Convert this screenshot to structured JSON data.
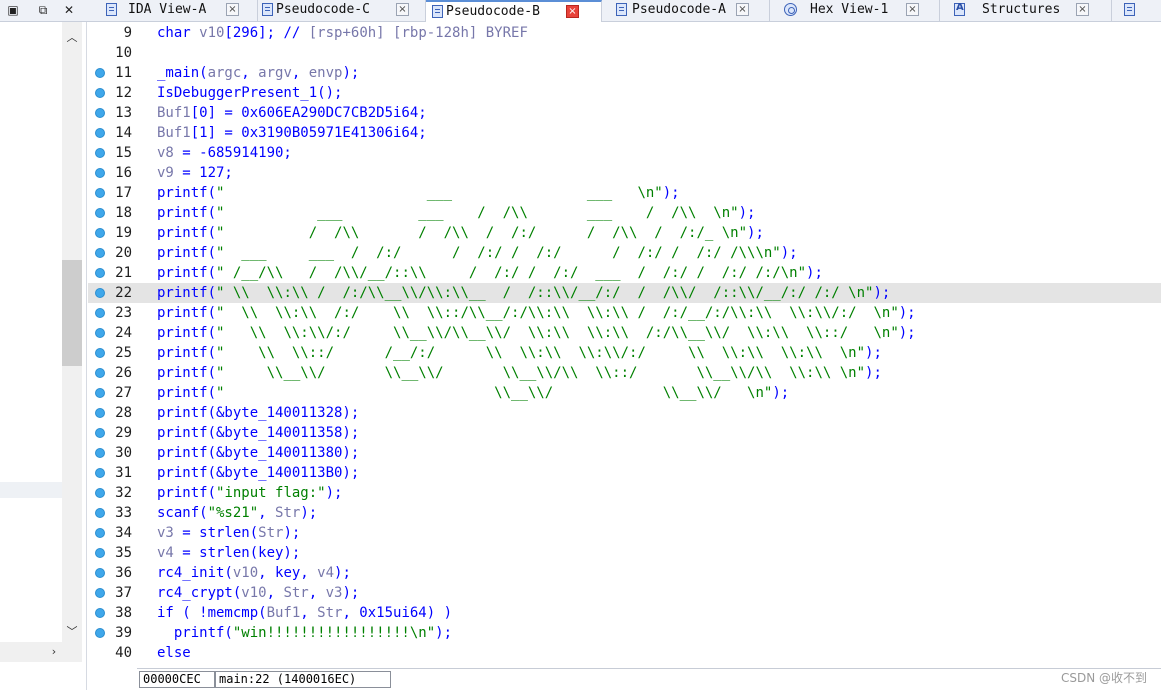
{
  "window_controls": {
    "float_icon": "window-float-icon",
    "restore_icon": "window-restore-icon",
    "close_icon": "window-close-icon"
  },
  "tabs": [
    {
      "label": "IDA View-A",
      "icon": "disassembly-view-icon",
      "active": false
    },
    {
      "label": "Pseudocode-C",
      "icon": "pseudocode-icon",
      "active": false
    },
    {
      "label": "Pseudocode-B",
      "icon": "pseudocode-icon",
      "active": true
    },
    {
      "label": "Pseudocode-A",
      "icon": "pseudocode-icon",
      "active": false
    },
    {
      "label": "Hex View-1",
      "icon": "hex-view-icon",
      "active": false
    },
    {
      "label": "Structures",
      "icon": "structures-icon",
      "active": false
    }
  ],
  "code": {
    "highlighted_line": 22,
    "lines": [
      {
        "num": "9",
        "bp": false,
        "text": "char v10[296]; // [rsp+60h] [rbp-128h] BYREF"
      },
      {
        "num": "10",
        "bp": false,
        "text": ""
      },
      {
        "num": "11",
        "bp": true,
        "text": "_main(argc, argv, envp);"
      },
      {
        "num": "12",
        "bp": true,
        "text": "IsDebuggerPresent_1();"
      },
      {
        "num": "13",
        "bp": true,
        "text": "Buf1[0] = 0x606EA290DC7CB2D5i64;"
      },
      {
        "num": "14",
        "bp": true,
        "text": "Buf1[1] = 0x3190B05971E41306i64;"
      },
      {
        "num": "15",
        "bp": true,
        "text": "v8 = -685914190;"
      },
      {
        "num": "16",
        "bp": true,
        "text": "v9 = 127;"
      },
      {
        "num": "17",
        "bp": true,
        "text": "printf(\"                        ___                ___   \\n\");"
      },
      {
        "num": "18",
        "bp": true,
        "text": "printf(\"           ___         ___    /  /\\\\       ___    /  /\\\\  \\n\");"
      },
      {
        "num": "19",
        "bp": true,
        "text": "printf(\"          /  /\\\\       /  /\\\\  /  /:/      /  /\\\\  /  /:/_ \\n\");"
      },
      {
        "num": "20",
        "bp": true,
        "text": "printf(\"  ___     ___  /  /:/      /  /:/ /  /:/      /  /:/ /  /:/ /\\\\\\n\");"
      },
      {
        "num": "21",
        "bp": true,
        "text": "printf(\" /__/\\\\   /  /\\\\/__/::\\\\     /  /:/ /  /:/  ___  /  /:/ /  /:/ /:/\\n\");"
      },
      {
        "num": "22",
        "bp": true,
        "text": "printf(\" \\\\  \\\\:\\\\ /  /:/\\\\__\\\\/\\\\:\\\\__  /  /::\\\\/__/:/  /  /\\\\/  /::\\\\/__/:/ /:/ \\n\");"
      },
      {
        "num": "23",
        "bp": true,
        "text": "printf(\"  \\\\  \\\\:\\\\  /:/    \\\\  \\\\::/\\\\__/:/\\\\:\\\\  \\\\:\\\\ /  /:/__/:/\\\\:\\\\  \\\\:\\\\/:/  \\n\");"
      },
      {
        "num": "24",
        "bp": true,
        "text": "printf(\"   \\\\  \\\\:\\\\/:/     \\\\__\\\\/\\\\__\\\\/  \\\\:\\\\  \\\\:\\\\  /:/\\\\__\\\\/  \\\\:\\\\  \\\\::/   \\n\");"
      },
      {
        "num": "25",
        "bp": true,
        "text": "printf(\"    \\\\  \\\\::/      /__/:/      \\\\  \\\\:\\\\  \\\\:\\\\/:/     \\\\  \\\\:\\\\  \\\\:\\\\  \\n\");"
      },
      {
        "num": "26",
        "bp": true,
        "text": "printf(\"     \\\\__\\\\/       \\\\__\\\\/       \\\\__\\\\/\\\\  \\\\::/       \\\\__\\\\/\\\\  \\\\:\\\\ \\n\");"
      },
      {
        "num": "27",
        "bp": true,
        "text": "printf(\"                                \\\\__\\\\/             \\\\__\\\\/   \\n\");"
      },
      {
        "num": "28",
        "bp": true,
        "text": "printf(&byte_140011328);"
      },
      {
        "num": "29",
        "bp": true,
        "text": "printf(&byte_140011358);"
      },
      {
        "num": "30",
        "bp": true,
        "text": "printf(&byte_140011380);"
      },
      {
        "num": "31",
        "bp": true,
        "text": "printf(&byte_1400113B0);"
      },
      {
        "num": "32",
        "bp": true,
        "text": "printf(\"input flag:\");"
      },
      {
        "num": "33",
        "bp": true,
        "text": "scanf(\"%s21\", Str);"
      },
      {
        "num": "34",
        "bp": true,
        "text": "v3 = strlen(Str);"
      },
      {
        "num": "35",
        "bp": true,
        "text": "v4 = strlen(key);"
      },
      {
        "num": "36",
        "bp": true,
        "text": "rc4_init(v10, key, v4);"
      },
      {
        "num": "37",
        "bp": true,
        "text": "rc4_crypt(v10, Str, v3);"
      },
      {
        "num": "38",
        "bp": true,
        "text": "if ( !memcmp(Buf1, Str, 0x15ui64) )"
      },
      {
        "num": "39",
        "bp": true,
        "text": "  printf(\"win!!!!!!!!!!!!!!!!!\\n\");"
      },
      {
        "num": "40",
        "bp": false,
        "text": "else"
      }
    ]
  },
  "status": {
    "offset": "00000CEC",
    "location": "main:22 (1400016EC)"
  },
  "watermark": "CSDN @收不到",
  "colors": {
    "keyword": "#0000ff",
    "string": "#008000",
    "variable": "#7777aa",
    "breakpoint": "#3fa7ea",
    "highlight": "#e4e4e4"
  }
}
